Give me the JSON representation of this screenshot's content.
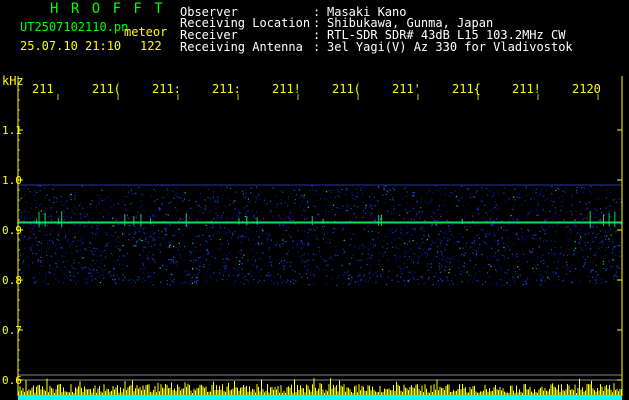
{
  "header": {
    "brand": "H R O F F T",
    "file_name": "UT2507102110.pn",
    "event_label": "meteor",
    "datetime": "25.07.10 21:10",
    "count": "122"
  },
  "station": {
    "labels": [
      "Observer",
      "Receiving Location",
      "Receiver",
      "Receiving Antenna"
    ],
    "separator": ":",
    "values": [
      "Masaki Kano",
      "Shibukawa, Gunma, Japan",
      "RTL-SDR SDR# 43dB L15 103.2MHz CW",
      "3el Yagi(V) Az 330 for Vladivostok"
    ]
  },
  "chart_data": {
    "type": "heatmap",
    "ylabel": "kHz",
    "y_ticks": [
      "1.1",
      "1.0",
      "0.9",
      "0.8",
      "0.7",
      "0.6"
    ],
    "x_ticks": [
      "211",
      "211(",
      "211:",
      "211:",
      "211!",
      "211(",
      "211'",
      "211{",
      "211!",
      "2120"
    ],
    "carrier_khz": 0.915,
    "band_khz": [
      0.79,
      0.99
    ],
    "colors": {
      "axis": "#ffff00",
      "grid": "#ffffff",
      "signal_low": "#1020ff",
      "signal_high": "#00ff60",
      "bar": "#ffff00",
      "bar_base": "#00ffff"
    }
  }
}
